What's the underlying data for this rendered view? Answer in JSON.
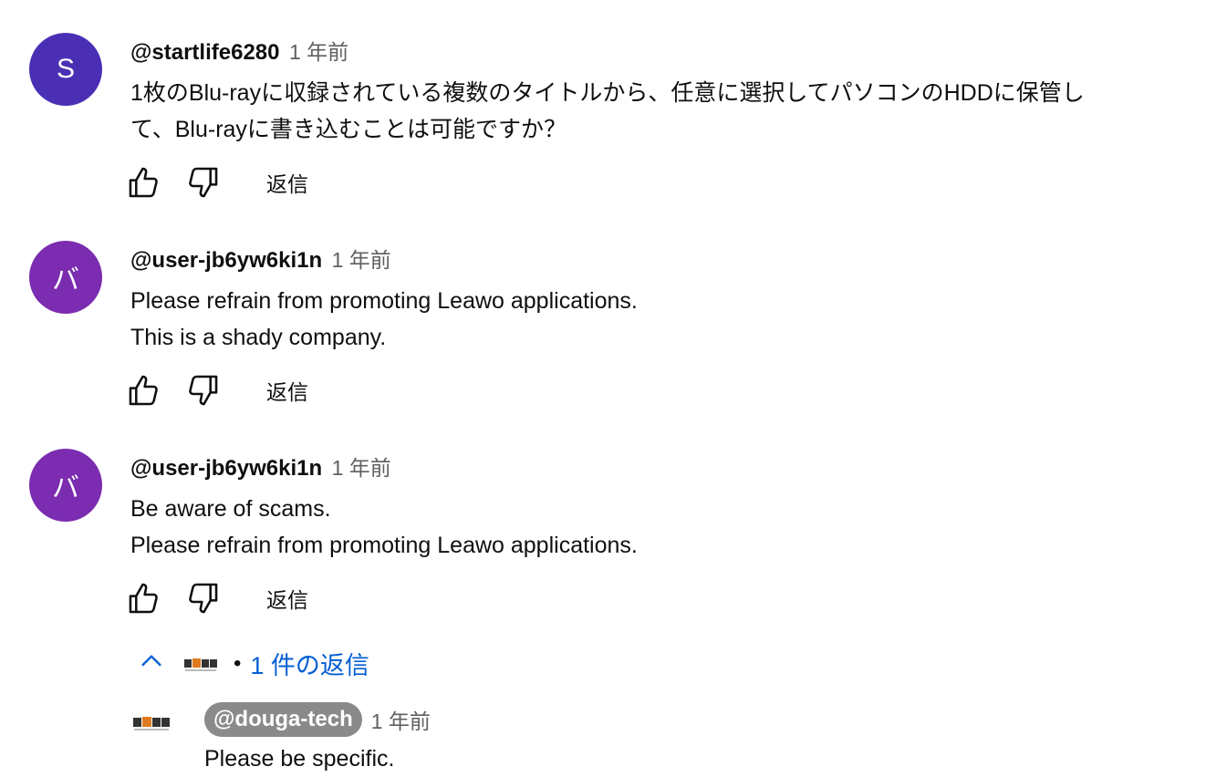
{
  "comments": [
    {
      "avatar_letter": "S",
      "avatar_color": "#4a2fb5",
      "author": "@startlife6280",
      "time": "1 年前",
      "lines": [
        "1枚のBlu-rayに収録されている複数のタイトルから、任意に選択してパソコンのHDDに保管し",
        "て、Blu-rayに書き込むことは可能ですか？"
      ],
      "reply_label": "返信"
    },
    {
      "avatar_letter": "バ",
      "avatar_color": "#7b2cb0",
      "author": "@user-jb6yw6ki1n",
      "time": "1 年前",
      "lines": [
        "Please refrain from promoting Leawo applications.",
        "This is a shady company."
      ],
      "reply_label": "返信"
    },
    {
      "avatar_letter": "バ",
      "avatar_color": "#7b2cb0",
      "author": "@user-jb6yw6ki1n",
      "time": "1 年前",
      "lines": [
        "Be aware of scams.",
        "Please refrain from promoting Leawo applications."
      ],
      "reply_label": "返信"
    }
  ],
  "replies_toggle": {
    "icon": "chevron-up-icon",
    "bullet": "•",
    "label": "1 件の返信"
  },
  "reply": {
    "author": "@douga-tech",
    "time": "1 年前",
    "text": "Please be specific."
  },
  "icons": {
    "like": "thumbs-up-icon",
    "dislike": "thumbs-down-icon"
  }
}
